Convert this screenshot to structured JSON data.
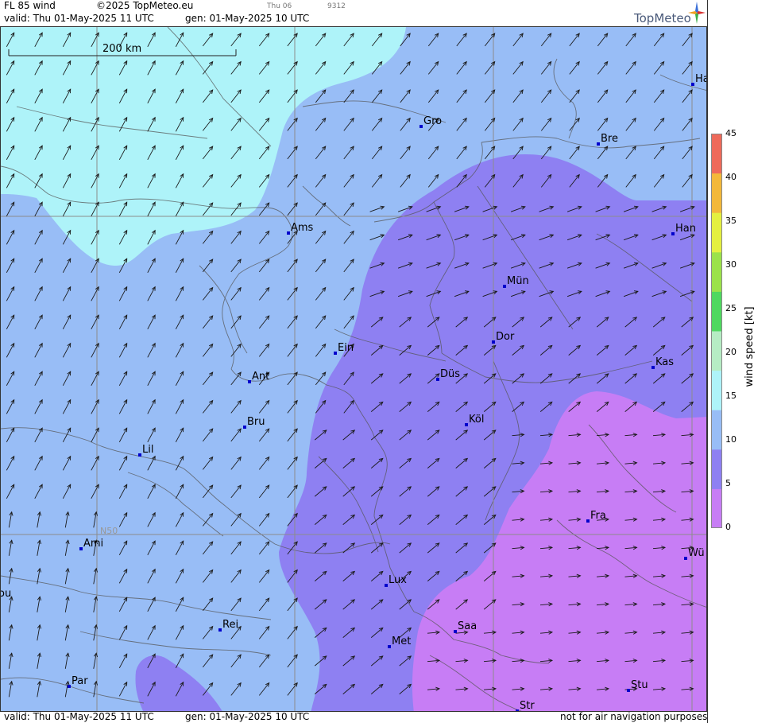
{
  "header": {
    "product": "FL 85 wind",
    "copyright": "©2025 TopMeteo.eu",
    "day": "Thu 06",
    "code": "9312",
    "valid": "valid:  Thu  01-May-2025  11 UTC",
    "gen": "gen: 01-May-2025 10 UTC",
    "brand": "TopMeteo"
  },
  "footer": {
    "valid": "valid:  Thu  01-May-2025  11 UTC",
    "gen": "gen: 01-May-2025 10 UTC",
    "disclaimer": "not for air navigation purposes"
  },
  "map": {
    "scale_label": "200 km",
    "gridline_label": "N50",
    "cities": [
      {
        "name": "Ha"
      },
      {
        "name": "Gro"
      },
      {
        "name": "Bre"
      },
      {
        "name": "Ams"
      },
      {
        "name": "Han"
      },
      {
        "name": "Mün"
      },
      {
        "name": "Ein"
      },
      {
        "name": "Dor"
      },
      {
        "name": "Ant"
      },
      {
        "name": "Düs"
      },
      {
        "name": "Kas"
      },
      {
        "name": "Bru"
      },
      {
        "name": "Köl"
      },
      {
        "name": "Lil"
      },
      {
        "name": "Fra"
      },
      {
        "name": "Ami"
      },
      {
        "name": "Wü"
      },
      {
        "name": "Lux"
      },
      {
        "name": "ou"
      },
      {
        "name": "Rei"
      },
      {
        "name": "Saa"
      },
      {
        "name": "Met"
      },
      {
        "name": "Stu"
      },
      {
        "name": "Par"
      },
      {
        "name": "Str"
      }
    ]
  },
  "legend": {
    "title": "wind  speed  [kt]",
    "ticks": [
      "45",
      "40",
      "35",
      "30",
      "25",
      "20",
      "15",
      "10",
      "5",
      "0"
    ],
    "colors": [
      "#c77df5",
      "#8e80f2",
      "#98bdf6",
      "#aef3f9",
      "#b6ecc4",
      "#4fd860",
      "#9be24a",
      "#e4f040",
      "#f3b83a",
      "#ee6a5a"
    ]
  },
  "colors": {
    "cyan": "#aef3f9",
    "lightblue": "#98bdf6",
    "purple": "#8e80f2",
    "violet": "#c77df5",
    "city_marker": "#0000cc",
    "arrow": "#1a1a1a"
  }
}
